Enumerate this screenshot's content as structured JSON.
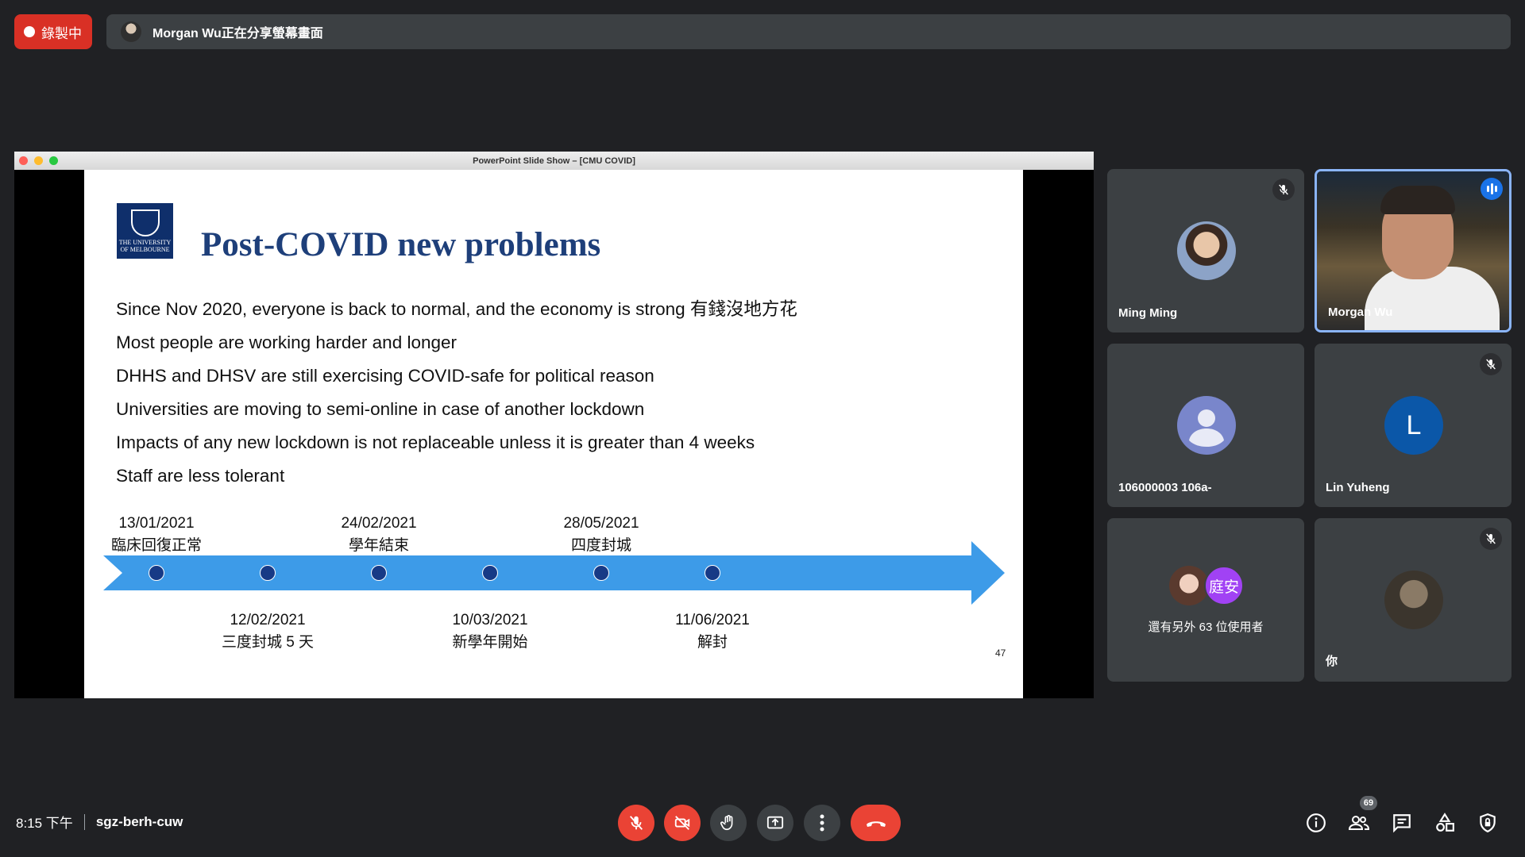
{
  "recording": {
    "label": "錄製中"
  },
  "share_banner": {
    "text": "Morgan Wu正在分享螢幕畫面"
  },
  "presentation": {
    "window_title": "PowerPoint Slide Show – [CMU COVID]",
    "logo_text": "THE UNIVERSITY OF MELBOURNE",
    "slide_title": "Post-COVID new problems",
    "bullets": [
      "Since Nov 2020, everyone is back to normal, and the economy is strong 有錢沒地方花",
      "Most people are working harder and longer",
      "DHHS and DHSV are still exercising COVID-safe for political reason",
      "Universities are moving to semi-online in case of another lockdown",
      "Impacts of any new lockdown is not replaceable unless it is greater than 4 weeks",
      "Staff are less tolerant"
    ],
    "timeline": [
      {
        "date": "13/01/2021",
        "label": "臨床回復正常",
        "position": "above"
      },
      {
        "date": "12/02/2021",
        "label": "三度封城 5 天",
        "position": "below"
      },
      {
        "date": "24/02/2021",
        "label": "學年結束",
        "position": "above"
      },
      {
        "date": "10/03/2021",
        "label": "新學年開始",
        "position": "below"
      },
      {
        "date": "28/05/2021",
        "label": "四度封城",
        "position": "above"
      },
      {
        "date": "11/06/2021",
        "label": "解封",
        "position": "below"
      }
    ],
    "slide_number": "47"
  },
  "participants": [
    {
      "name": "Ming Ming",
      "muted": true
    },
    {
      "name": "Morgan Wu",
      "speaking": true
    },
    {
      "name": "106000003 106a-",
      "muted": false
    },
    {
      "name": "Lin Yuheng",
      "initial": "L",
      "muted": true
    },
    {
      "name": "還有另外 63 位使用者",
      "initial": "庭安"
    },
    {
      "name": "你",
      "muted": true
    }
  ],
  "bottom_bar": {
    "time": "8:15 下午",
    "meeting_code": "sgz-berh-cuw",
    "participant_count": "69"
  },
  "colors": {
    "background": "#202124",
    "recording": "#d93025",
    "tile": "#3c4043",
    "danger": "#ea4335",
    "slide_title": "#1e3f7a",
    "timeline": "#3d9be8",
    "timeline_dot": "#173a86"
  }
}
